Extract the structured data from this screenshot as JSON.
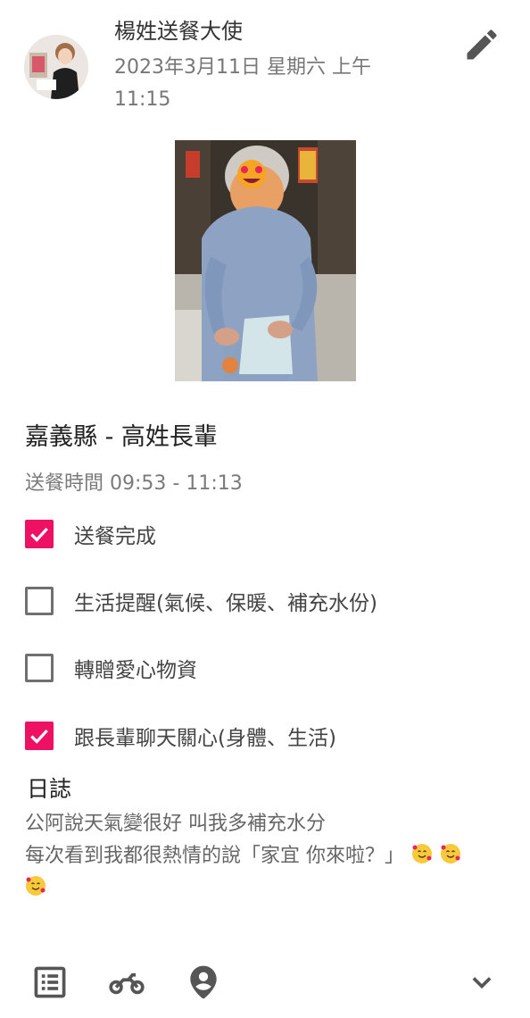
{
  "post": {
    "author": "楊姓送餐大使",
    "datetime": "2023年3月11日 星期六 上午 11:15"
  },
  "record": {
    "title": "嘉義縣 - 高姓長輩",
    "time_text": "送餐時間 09:53 - 11:13"
  },
  "checklist": [
    {
      "label": "送餐完成",
      "checked": true
    },
    {
      "label": "生活提醒(氣候、保暖、補充水份)",
      "checked": false
    },
    {
      "label": "轉贈愛心物資",
      "checked": false
    },
    {
      "label": "跟長輩聊天關心(身體、生活)",
      "checked": true
    }
  ],
  "journal": {
    "heading": "日誌",
    "line1": "公阿說天氣變很好 叫我多補充水分",
    "line2": "每次看到我都很熱情的說「家宜 你來啦？」",
    "emoji_count": 3,
    "emoji_icon": "smiling-face-with-hearts"
  },
  "colors": {
    "accent": "#ee1163",
    "secondary_text": "#777777",
    "icon": "#555555"
  },
  "icons": [
    "edit-pencil",
    "list-alt",
    "motorcycle",
    "person-pin",
    "chevron-down"
  ]
}
